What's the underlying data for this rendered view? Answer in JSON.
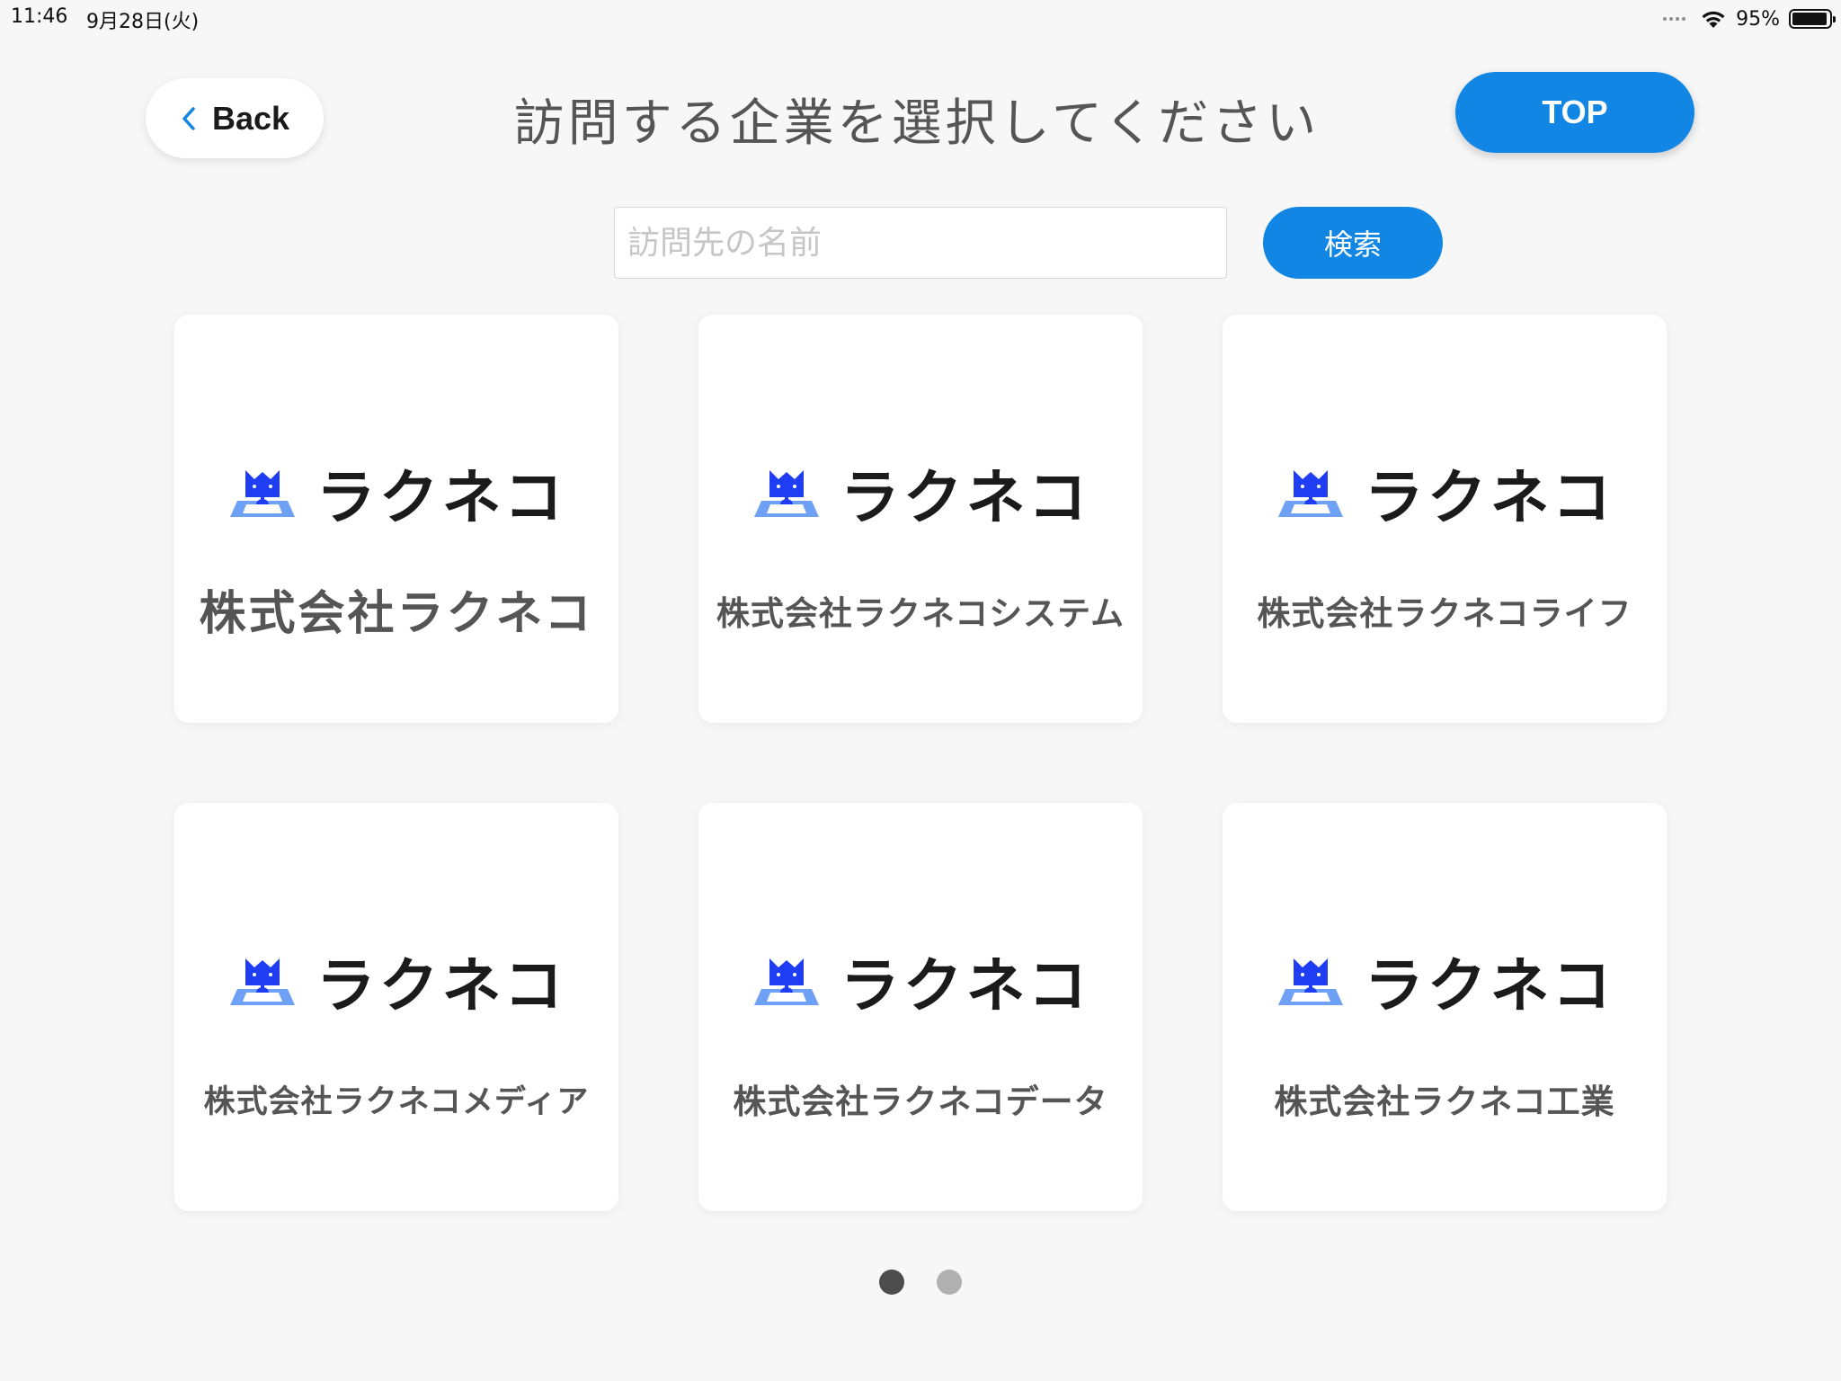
{
  "status_bar": {
    "time": "11:46",
    "date": "9月28日(火)",
    "battery_pct": "95%",
    "battery_level": 0.95
  },
  "header": {
    "back_label": "Back",
    "title": "訪問する企業を選択してください",
    "top_label": "TOP"
  },
  "search": {
    "placeholder": "訪問先の名前",
    "value": "",
    "button_label": "検索"
  },
  "logo": {
    "text": "ラクネコ",
    "icon": "rakuneko-cat-icon",
    "brand_color": "#1f3df2",
    "accent_color": "#6ea0f5"
  },
  "companies": [
    {
      "name": "株式会社ラクネコ"
    },
    {
      "name": "株式会社ラクネコシステム"
    },
    {
      "name": "株式会社ラクネコライフ"
    },
    {
      "name": "株式会社ラクネコメディア"
    },
    {
      "name": "株式会社ラクネコデータ"
    },
    {
      "name": "株式会社ラクネコ工業"
    }
  ],
  "pagination": {
    "current_page": 1,
    "total_pages": 2
  },
  "colors": {
    "primary": "#1186e5",
    "background": "#f7f7f7",
    "card": "#ffffff",
    "title_text": "#555555"
  }
}
